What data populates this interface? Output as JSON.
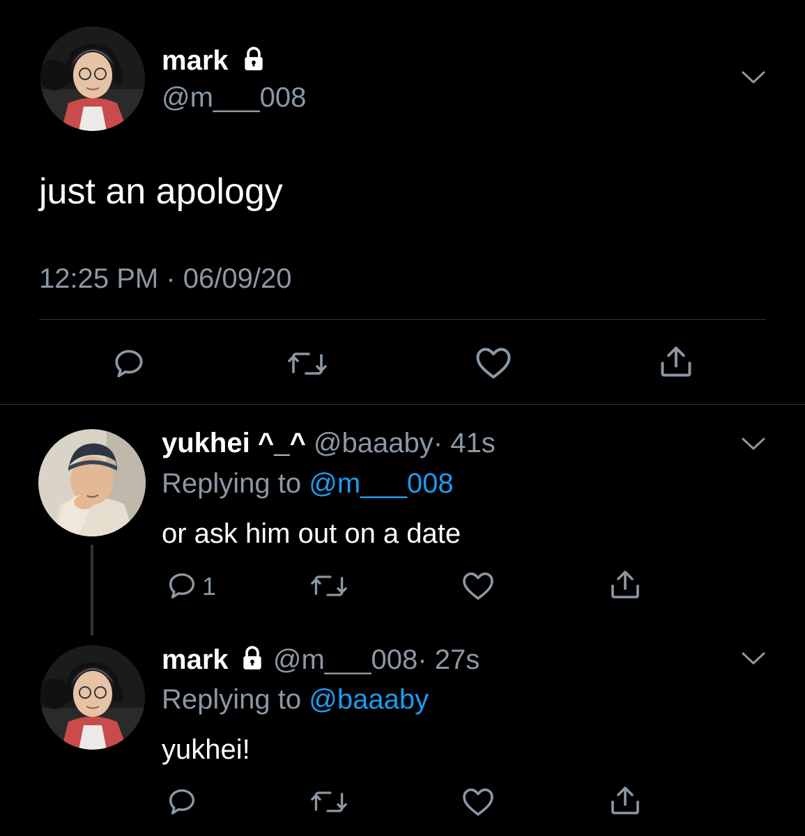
{
  "main_tweet": {
    "display_name": "mark",
    "handle": "@m___008",
    "text": "just an apology",
    "timestamp": "12:25 PM · 06/09/20",
    "avatar_icon": "avatar-mark",
    "lock_icon": "lock-icon"
  },
  "replies": [
    {
      "display_name": "yukhei ^_^",
      "handle": "@baaaby",
      "time": "· 41s",
      "replying_prefix": "Replying to",
      "replying_to": "@m___008",
      "text": "or ask him out on a date",
      "reply_count": "1"
    },
    {
      "display_name": "mark",
      "handle": "@m___008",
      "time": "· 27s",
      "replying_prefix": "Replying to",
      "replying_to": "@baaaby",
      "text": "yukhei!",
      "reply_count": ""
    }
  ],
  "colors": {
    "background": "#000000",
    "text": "#ffffff",
    "muted": "#8b98a5",
    "link": "#1d9bf0",
    "divider": "#2f3336"
  },
  "icons": [
    "reply-icon",
    "retweet-icon",
    "like-icon",
    "share-icon",
    "chevron-down-icon",
    "lock-icon"
  ]
}
